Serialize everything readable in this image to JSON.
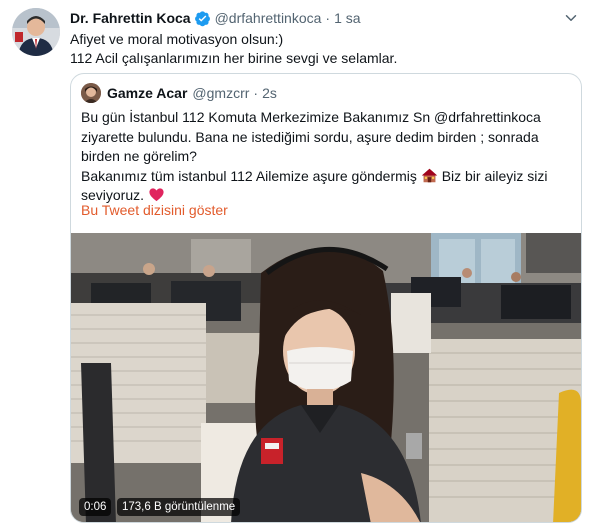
{
  "tweet": {
    "author_name": "Dr. Fahrettin Koca",
    "author_handle": "@drfahrettinkoca",
    "separator": "·",
    "time": "1 sa",
    "text_lines": [
      "Afiyet ve moral motivasyon olsun:)",
      "112 Acil çalışanlarımızın her birine sevgi ve selamlar."
    ]
  },
  "quoted": {
    "author_name": "Gamze Acar",
    "author_handle": "@gmzcrr",
    "separator": "·",
    "time": "2s",
    "text_lines": [
      "Bu gün İstanbul 112 Komuta Merkezimize Bakanımız Sn @drfahrettinkoca",
      "ziyarette bulundu. Bana ne istediğimi sordu, aşure dedim birden ; sonrada",
      "birden ne görelim?",
      "Bakanımız tüm istanbul 112 Ailemize aşure göndermiş",
      "Biz bir aileyiz sizi",
      "seviyoruz."
    ],
    "thread_link": "Bu Tweet dizisini göster",
    "video": {
      "duration": "0:06",
      "views": "173,6 B görüntülenme"
    }
  },
  "icons": {
    "verified": "verified-badge-icon",
    "more": "chevron-down-icon",
    "house_emoji": "house-emoji-icon",
    "heart_emoji": "red-heart-emoji-icon"
  },
  "colors": {
    "verified_blue": "#1d9bf0",
    "link_orange": "#e25b2c",
    "heart_red": "#e0245e",
    "secondary_text": "#536471",
    "border": "#cfd9de"
  }
}
